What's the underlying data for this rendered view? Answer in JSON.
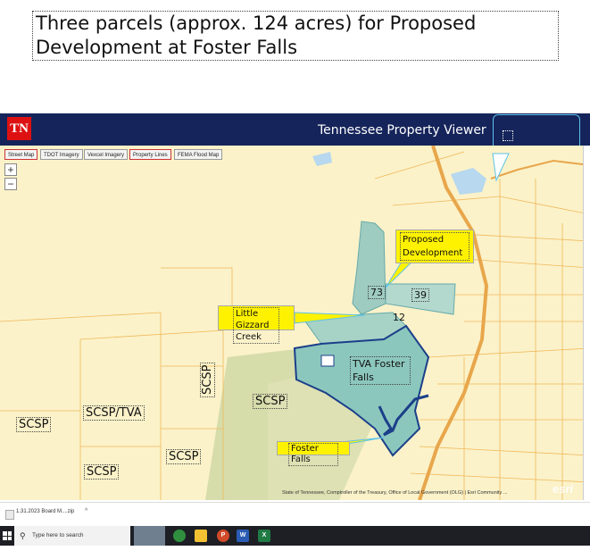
{
  "slide": {
    "title": "Three parcels (approx. 124 acres) for Proposed Development at Foster Falls"
  },
  "viewer": {
    "logo_text": "TN",
    "title": "Tennessee Property Viewer",
    "layers": [
      {
        "label": "Street Map",
        "active": true
      },
      {
        "label": "TDOT Imagery",
        "active": false
      },
      {
        "label": "Vexcel Imagery",
        "active": false
      },
      {
        "label": "Property Lines",
        "active": true
      },
      {
        "label": "FEMA Flood Map",
        "active": false
      }
    ],
    "zoom_in": "+",
    "zoom_out": "−"
  },
  "map": {
    "parcel_labels": {
      "p73": "73",
      "p39": "39",
      "p12": "12"
    },
    "area_labels": {
      "tva_foster_falls": "TVA Foster Falls",
      "scsp_1": "SCSP",
      "scsp_tva": "SCSP/TVA",
      "scsp_2": "SCSP",
      "scsp_3": "SCSP",
      "scsp_4": "SCSP",
      "scsp_vertical": "SCSP"
    },
    "callouts": {
      "proposed": "Proposed Development",
      "little_gizzard": "Little Gizzard Creek",
      "foster_falls": "Foster Falls"
    },
    "attribution": "State of Tennessee, Comptroller of the Treasury, Office of Local Government (OLG) | Esri Community ...",
    "esri": "esri"
  },
  "download_bar": {
    "item": "1.31.2023 Board M....zip",
    "chevron": "^"
  },
  "taskbar": {
    "search_placeholder": "Type here to search"
  },
  "colors": {
    "header": "#15245a",
    "map_bg": "#fbf2c9",
    "parcel_fill": "#8cc7bd",
    "callout": "#fff200"
  }
}
